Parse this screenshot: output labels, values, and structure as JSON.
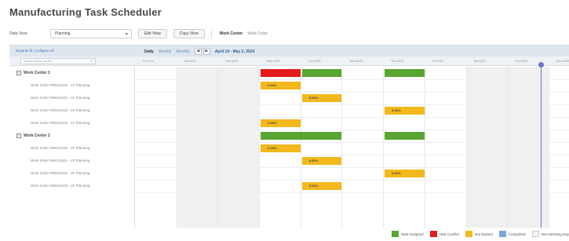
{
  "app": {
    "title": "Manufacturing Task Scheduler"
  },
  "toolbar": {
    "view_label": "Data View",
    "view_value": "Planning",
    "edit_view": "Edit View",
    "copy_view": "Copy View",
    "work_center": "Work Center",
    "work_order": "Work Order"
  },
  "grid": {
    "expand_all": "Expand All",
    "collapse_all": "Collapse All",
    "search_placeholder": "Search Work Center",
    "tabs": [
      "Daily",
      "Weekly",
      "Monthly"
    ],
    "date_range": "April 19 - May 2, 2024",
    "columns": [
      "Fri 04/19",
      "Sat 04/20",
      "Sun 04/21",
      "Mon 04/22",
      "Tue 04/23",
      "Wed 04/24",
      "Thu 04/25",
      "Fri 04/26",
      "Sat 04/27",
      "Sun 04/28",
      "Mon 04/29"
    ]
  },
  "rows": [
    {
      "type": "group",
      "label": "Work Center 1"
    },
    {
      "type": "child",
      "label": "Work Order #WO10430 - 1F Planning"
    },
    {
      "type": "child",
      "label": "Work Order #WO10431 - 1F Planning"
    },
    {
      "type": "child",
      "label": "Work Order #WO10432 - 1F Planning"
    },
    {
      "type": "child",
      "label": "Work Order #WO10433 - 1F Planning"
    },
    {
      "type": "group",
      "label": "Work Center 2"
    },
    {
      "type": "child",
      "label": "Work Order #WO10440 - 2F Planning"
    },
    {
      "type": "child",
      "label": "Work Order #WO10441 - 2F Planning"
    },
    {
      "type": "child",
      "label": "Work Order #WO10442 - 2F Planning"
    },
    {
      "type": "child",
      "label": "Work Order #WO10443 - 2F Planning"
    }
  ],
  "bars": [
    {
      "row": 0,
      "col": 3,
      "span": 1,
      "status": "red",
      "label": ""
    },
    {
      "row": 0,
      "col": 4,
      "span": 1,
      "status": "green",
      "label": ""
    },
    {
      "row": 0,
      "col": 6,
      "span": 1,
      "status": "green",
      "label": ""
    },
    {
      "row": 1,
      "col": 3,
      "span": 0.5,
      "status": "yellow",
      "label": "0.00%"
    },
    {
      "row": 2,
      "col": 4,
      "span": 0.5,
      "status": "yellow",
      "label": "0.00%"
    },
    {
      "row": 3,
      "col": 6,
      "span": 0.5,
      "status": "yellow",
      "label": "0.00%"
    },
    {
      "row": 4,
      "col": 3,
      "span": 1,
      "status": "yellow",
      "label": "0.00%"
    },
    {
      "row": 5,
      "col": 3,
      "span": 2,
      "status": "green",
      "label": ""
    },
    {
      "row": 5,
      "col": 6,
      "span": 1,
      "status": "green",
      "label": ""
    },
    {
      "row": 6,
      "col": 3,
      "span": 1,
      "status": "yellow",
      "label": "0.00%"
    },
    {
      "row": 7,
      "col": 4,
      "span": 1,
      "status": "yellow",
      "label": "0.00%"
    },
    {
      "row": 8,
      "col": 6,
      "span": 1,
      "status": "yellow",
      "label": "0.00%"
    },
    {
      "row": 9,
      "col": 4,
      "span": 1,
      "status": "yellow",
      "label": "0.00%"
    }
  ],
  "weekend_cols": [
    1,
    2,
    8,
    9
  ],
  "today_col": 9.8,
  "legend": [
    {
      "label": "Task Assigned",
      "color": "#5aa532"
    },
    {
      "label": "Task Conflict",
      "color": "#e31b1b"
    },
    {
      "label": "Not Started",
      "color": "#f2b81c"
    },
    {
      "label": "Completed",
      "color": "#7fa6dc"
    },
    {
      "label": "Non-Working Day",
      "color": "#f3f3f3"
    }
  ],
  "colors": {
    "today_line": "#6f73cf",
    "header_bg": "#dfe6ee"
  }
}
